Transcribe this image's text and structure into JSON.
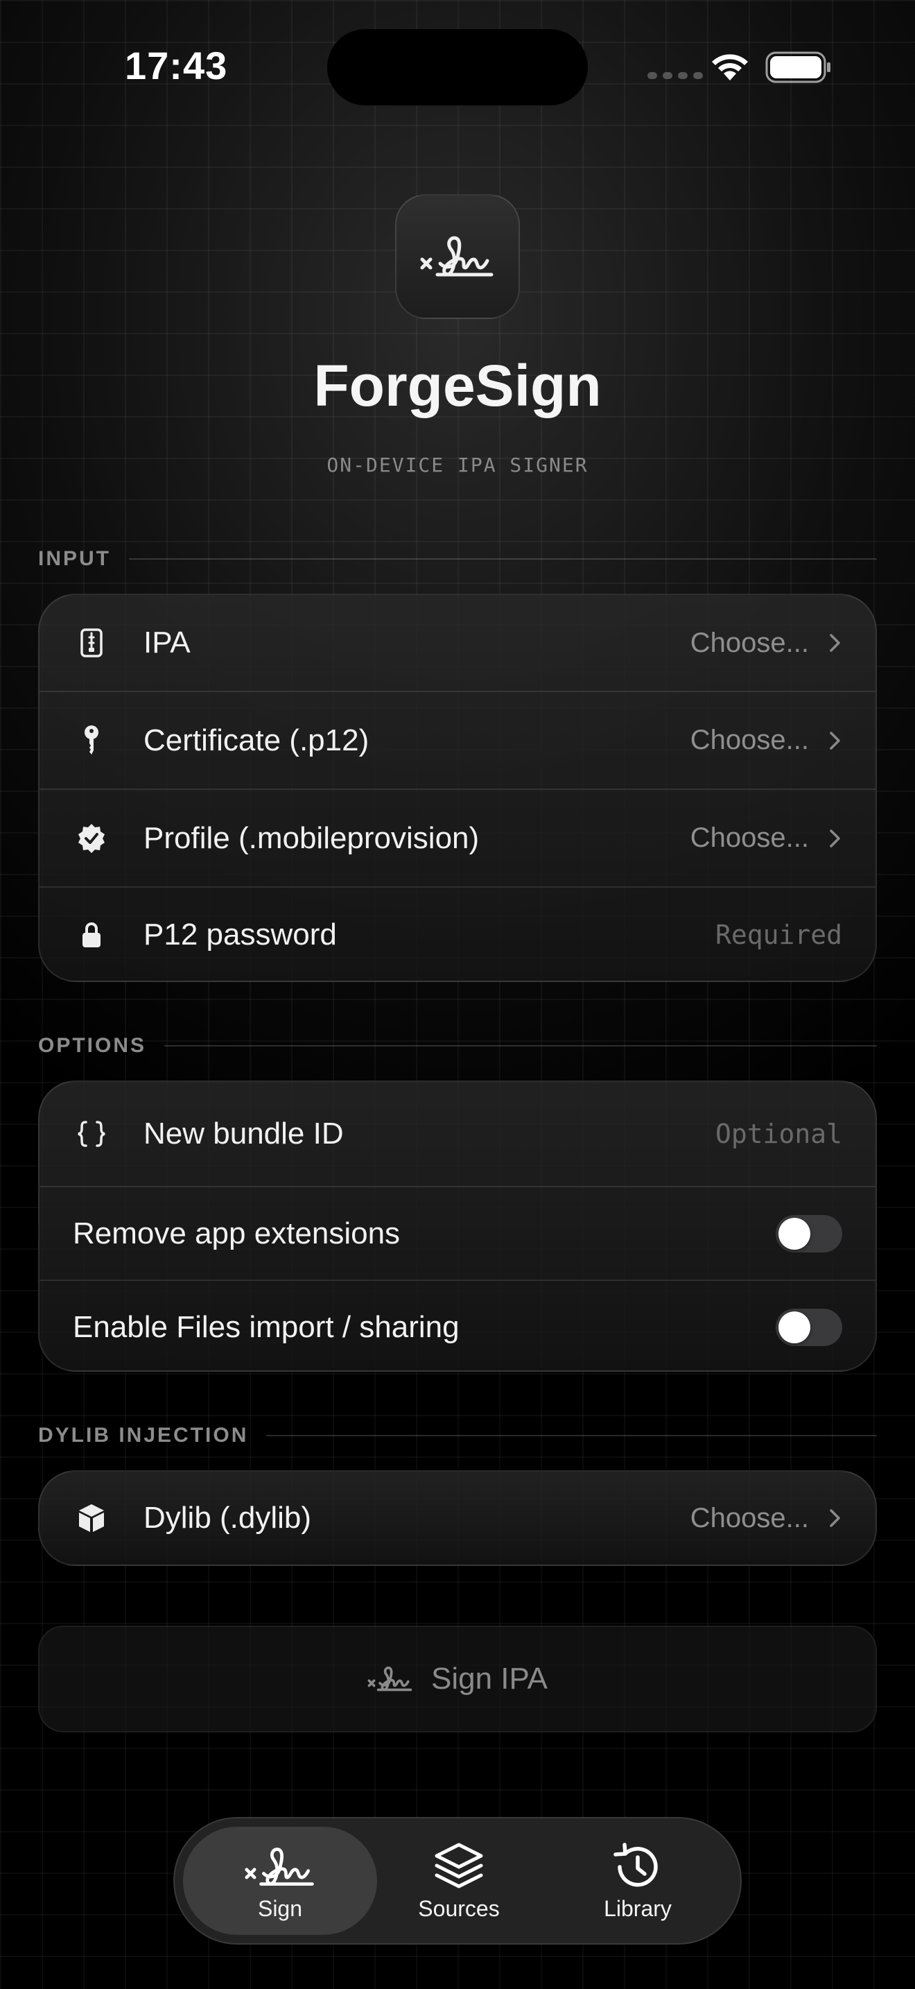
{
  "status_bar": {
    "time": "17:43"
  },
  "header": {
    "app_name": "ForgeSign",
    "subtitle": "ON-DEVICE IPA SIGNER",
    "icon": "signature-icon"
  },
  "sections": {
    "input": {
      "title": "INPUT",
      "rows": [
        {
          "label": "IPA",
          "value": "Choose...",
          "icon": "zip-file-icon"
        },
        {
          "label": "Certificate (.p12)",
          "value": "Choose...",
          "icon": "key-icon"
        },
        {
          "label": "Profile (.mobileprovision)",
          "value": "Choose...",
          "icon": "checkmark-seal-icon"
        },
        {
          "label": "P12 password",
          "placeholder": "Required",
          "value": "",
          "icon": "lock-icon"
        }
      ]
    },
    "options": {
      "title": "OPTIONS",
      "bundle_id": {
        "label": "New bundle ID",
        "placeholder": "Optional",
        "value": "",
        "icon": "curly-braces-icon"
      },
      "toggles": [
        {
          "label": "Remove app extensions",
          "on": false
        },
        {
          "label": "Enable Files import / sharing",
          "on": false
        }
      ]
    },
    "dylib": {
      "title": "DYLIB INJECTION",
      "row": {
        "label": "Dylib (.dylib)",
        "value": "Choose...",
        "icon": "cube-icon"
      }
    }
  },
  "sign_button": {
    "label": "Sign IPA",
    "enabled": false
  },
  "tab_bar": {
    "tabs": [
      {
        "label": "Sign",
        "icon": "signature-icon",
        "active": true
      },
      {
        "label": "Sources",
        "icon": "stack-icon",
        "active": false
      },
      {
        "label": "Library",
        "icon": "history-clock-icon",
        "active": false
      }
    ]
  },
  "colors": {
    "background": "#000000",
    "card": "#1e1e1e",
    "text_primary": "#f2f2f2",
    "text_secondary": "#8f8f8f",
    "toggle_off": "#3a3a3c"
  }
}
